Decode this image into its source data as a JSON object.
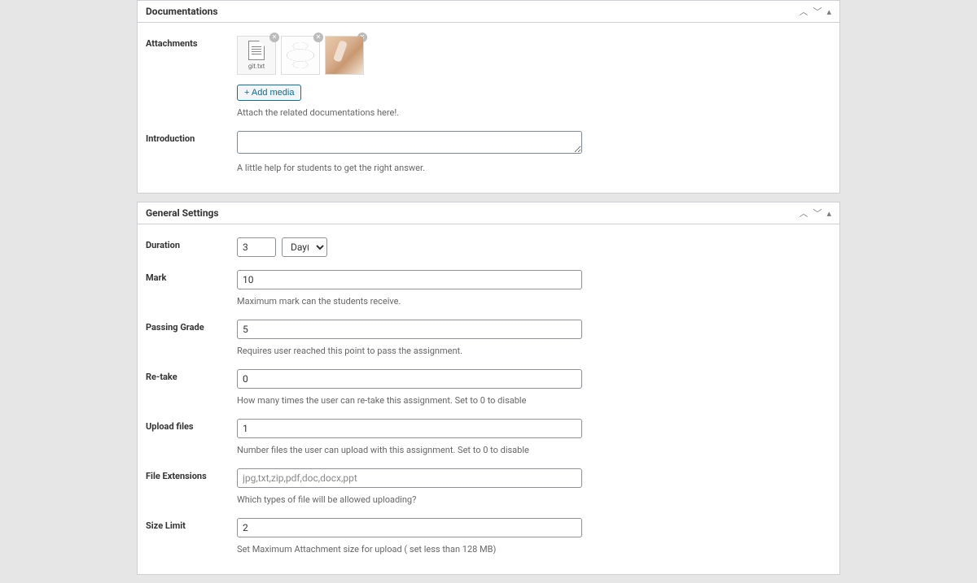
{
  "panels": {
    "documentations": {
      "title": "Documentations",
      "fields": {
        "attachments": {
          "label": "Attachments",
          "file1_name": "git.txt",
          "add_media_label": "+ Add media",
          "helper": "Attach the related documentations here!."
        },
        "introduction": {
          "label": "Introduction",
          "value": "",
          "helper": "A little help for students to get the right answer."
        }
      }
    },
    "general": {
      "title": "General Settings",
      "fields": {
        "duration": {
          "label": "Duration",
          "value": "3",
          "unit": "Day(s)"
        },
        "mark": {
          "label": "Mark",
          "value": "10",
          "helper": "Maximum mark can the students receive."
        },
        "passing_grade": {
          "label": "Passing Grade",
          "value": "5",
          "helper": "Requires user reached this point to pass the assignment."
        },
        "retake": {
          "label": "Re-take",
          "value": "0",
          "helper": "How many times the user can re-take this assignment. Set to 0 to disable"
        },
        "upload_files": {
          "label": "Upload files",
          "value": "1",
          "helper": "Number files the user can upload with this assignment. Set to 0 to disable"
        },
        "file_extensions": {
          "label": "File Extensions",
          "placeholder": "jpg,txt,zip,pdf,doc,docx,ppt",
          "value": "",
          "helper": "Which types of file will be allowed uploading?"
        },
        "size_limit": {
          "label": "Size Limit",
          "value": "2",
          "helper": "Set Maximum Attachment size for upload ( set less than 128 MB)"
        }
      }
    }
  }
}
